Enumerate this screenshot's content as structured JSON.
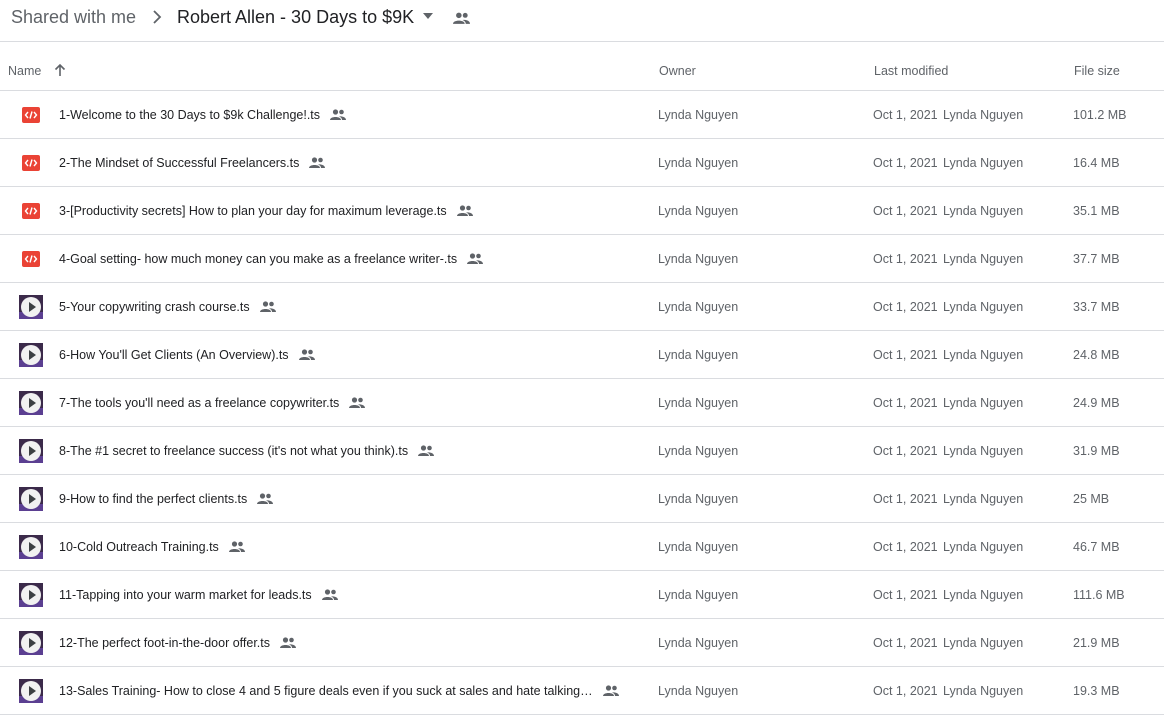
{
  "breadcrumb": {
    "root": "Shared with me",
    "current": "Robert Allen - 30 Days to $9K"
  },
  "columns": {
    "name": "Name",
    "owner": "Owner",
    "last_modified": "Last modified",
    "file_size": "File size"
  },
  "icons": {
    "separator": "chevron-right-icon",
    "caret": "caret-down-icon",
    "shared": "shared-people-icon",
    "sort": "arrow-up-icon",
    "code": "code-file-icon",
    "video": "video-thumbnail-icon"
  },
  "colors": {
    "code_icon": "#ea4335",
    "muted_text": "#5f6368",
    "divider": "#dadce0"
  },
  "files": [
    {
      "name": "1-Welcome to the 30 Days to $9k Challenge!.ts",
      "type": "code",
      "owner": "Lynda Nguyen",
      "date": "Oct 1, 2021",
      "modified_by": "Lynda Nguyen",
      "size": "101.2 MB"
    },
    {
      "name": "2-The Mindset of Successful Freelancers.ts",
      "type": "code",
      "owner": "Lynda Nguyen",
      "date": "Oct 1, 2021",
      "modified_by": "Lynda Nguyen",
      "size": "16.4 MB"
    },
    {
      "name": "3-[Productivity secrets] How to plan your day for maximum leverage.ts",
      "type": "code",
      "owner": "Lynda Nguyen",
      "date": "Oct 1, 2021",
      "modified_by": "Lynda Nguyen",
      "size": "35.1 MB"
    },
    {
      "name": "4-Goal setting- how much money can you make as a freelance writer-.ts",
      "type": "code",
      "owner": "Lynda Nguyen",
      "date": "Oct 1, 2021",
      "modified_by": "Lynda Nguyen",
      "size": "37.7 MB"
    },
    {
      "name": "5-Your copywriting crash course.ts",
      "type": "video",
      "owner": "Lynda Nguyen",
      "date": "Oct 1, 2021",
      "modified_by": "Lynda Nguyen",
      "size": "33.7 MB"
    },
    {
      "name": "6-How You'll Get Clients (An Overview).ts",
      "type": "video",
      "owner": "Lynda Nguyen",
      "date": "Oct 1, 2021",
      "modified_by": "Lynda Nguyen",
      "size": "24.8 MB"
    },
    {
      "name": "7-The tools you'll need as a freelance copywriter.ts",
      "type": "video",
      "owner": "Lynda Nguyen",
      "date": "Oct 1, 2021",
      "modified_by": "Lynda Nguyen",
      "size": "24.9 MB"
    },
    {
      "name": "8-The #1 secret to freelance success (it's not what you think).ts",
      "type": "video",
      "owner": "Lynda Nguyen",
      "date": "Oct 1, 2021",
      "modified_by": "Lynda Nguyen",
      "size": "31.9 MB"
    },
    {
      "name": "9-How to find the perfect clients.ts",
      "type": "video",
      "owner": "Lynda Nguyen",
      "date": "Oct 1, 2021",
      "modified_by": "Lynda Nguyen",
      "size": "25 MB"
    },
    {
      "name": "10-Cold Outreach Training.ts",
      "type": "video",
      "owner": "Lynda Nguyen",
      "date": "Oct 1, 2021",
      "modified_by": "Lynda Nguyen",
      "size": "46.7 MB"
    },
    {
      "name": "11-Tapping into your warm market for leads.ts",
      "type": "video",
      "owner": "Lynda Nguyen",
      "date": "Oct 1, 2021",
      "modified_by": "Lynda Nguyen",
      "size": "111.6 MB"
    },
    {
      "name": "12-The perfect foot-in-the-door offer.ts",
      "type": "video",
      "owner": "Lynda Nguyen",
      "date": "Oct 1, 2021",
      "modified_by": "Lynda Nguyen",
      "size": "21.9 MB"
    },
    {
      "name": "13-Sales Training- How to close 4 and 5 figure deals even if you suck at sales and hate talking…",
      "type": "video",
      "owner": "Lynda Nguyen",
      "date": "Oct 1, 2021",
      "modified_by": "Lynda Nguyen",
      "size": "19.3 MB"
    }
  ]
}
